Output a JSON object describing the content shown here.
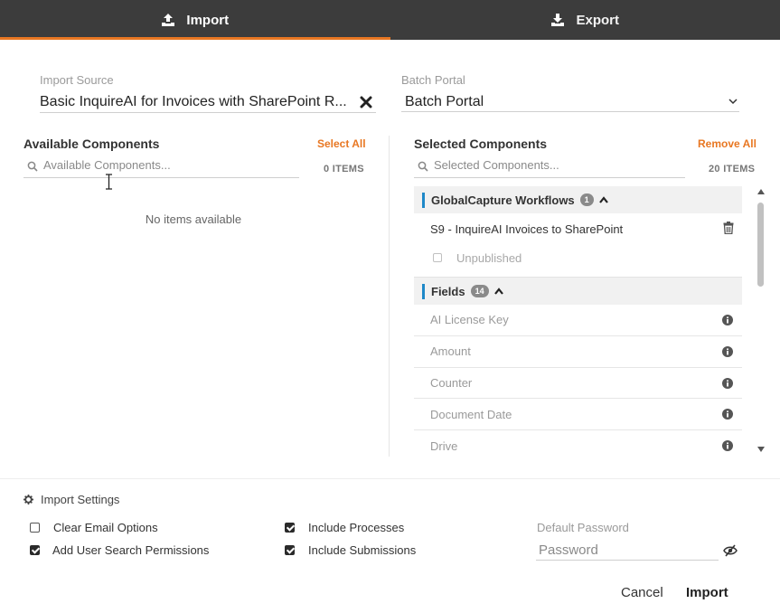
{
  "tabs": [
    {
      "label": "Import",
      "icon": "upload-icon",
      "active": true
    },
    {
      "label": "Export",
      "icon": "download-icon",
      "active": false
    }
  ],
  "import_source": {
    "label": "Import Source",
    "value": "Basic InquireAI for Invoices with SharePoint R..."
  },
  "batch_portal": {
    "label": "Batch Portal",
    "value": "Batch Portal"
  },
  "available": {
    "title": "Available Components",
    "action": "Select All",
    "search_placeholder": "Available Components...",
    "count": "0 ITEMS",
    "empty_text": "No items available"
  },
  "selected": {
    "title": "Selected Components",
    "action": "Remove All",
    "search_placeholder": "Selected Components...",
    "count": "20 ITEMS",
    "workflows_group": {
      "title": "GlobalCapture Workflows",
      "badge": "1",
      "item": "S9 - InquireAI Invoices to SharePoint",
      "unpublished_label": "Unpublished"
    },
    "fields_group": {
      "title": "Fields",
      "badge": "14",
      "items": [
        "AI License Key",
        "Amount",
        "Counter",
        "Document Date",
        "Drive"
      ]
    }
  },
  "settings": {
    "title": "Import Settings",
    "clear_email": {
      "label": "Clear Email Options",
      "checked": false
    },
    "add_user_search": {
      "label": "Add User Search Permissions",
      "checked": true
    },
    "include_processes": {
      "label": "Include Processes",
      "checked": true
    },
    "include_submissions": {
      "label": "Include Submissions",
      "checked": true
    },
    "password_label": "Default Password",
    "password_placeholder": "Password"
  },
  "footer": {
    "cancel": "Cancel",
    "import": "Import"
  },
  "colors": {
    "accent": "#e87722",
    "tab_bg": "#3c3c3c",
    "group_bar": "#1e88c8"
  }
}
